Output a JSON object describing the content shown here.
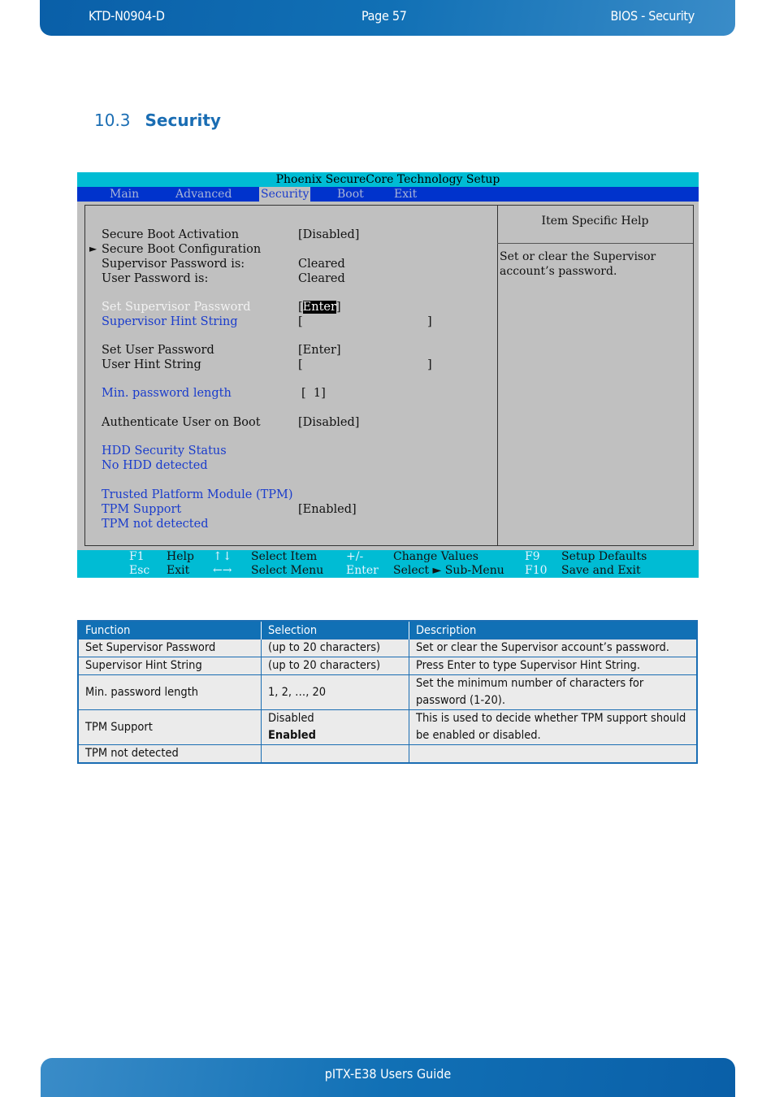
{
  "header": {
    "doc_id": "KTD-N0904-D",
    "page": "Page 57",
    "section": "BIOS  - Security"
  },
  "section": {
    "number": "10.3",
    "title": "Security"
  },
  "bios": {
    "title": "Phoenix SecureCore Technology Setup",
    "menu": [
      "Main",
      "Advanced",
      "Security",
      "Boot",
      "Exit"
    ],
    "active_menu": "Security",
    "items": [
      {
        "label": "Secure Boot Activation",
        "value": "[Disabled]",
        "color": "black"
      },
      {
        "label": "Secure Boot Configuration",
        "value": "",
        "color": "black",
        "submenu": true
      },
      {
        "label": "Supervisor Password is:",
        "value": "Cleared",
        "color": "black"
      },
      {
        "label": "User Password is:",
        "value": "Cleared",
        "color": "black"
      },
      {
        "label": "Set Supervisor Password",
        "value": "Enter",
        "color": "white",
        "selected": true
      },
      {
        "label": "Supervisor Hint String",
        "value": "[",
        "value_end": "]",
        "color": "blue"
      },
      {
        "label": "Set User Password",
        "value": "[Enter]",
        "color": "black"
      },
      {
        "label": "User Hint String",
        "value": "[",
        "value_end": "]",
        "color": "black"
      },
      {
        "label": "Min. password length",
        "value": "[  1]",
        "color": "blue"
      },
      {
        "label": "Authenticate User on Boot",
        "value": "[Disabled]",
        "color": "black"
      },
      {
        "label": "HDD Security Status",
        "value": "",
        "color": "blue"
      },
      {
        "label": "No HDD detected",
        "value": "",
        "color": "blue"
      },
      {
        "label": "Trusted Platform Module (TPM)",
        "value": "",
        "color": "blue"
      },
      {
        "label": "TPM Support",
        "value": "[Enabled]",
        "color": "blue"
      },
      {
        "label": "TPM not detected",
        "value": "",
        "color": "blue"
      }
    ],
    "help_title": "Item Specific Help",
    "help_text": "Set or clear the Supervisor account’s password.",
    "footer": [
      {
        "key": "F1",
        "desc": "Help"
      },
      {
        "key": "Esc",
        "desc": "Exit"
      },
      {
        "key": "↑↓",
        "desc": "Select Item"
      },
      {
        "key": "←→",
        "desc": "Select Menu"
      },
      {
        "key": "+/-",
        "desc": "Change Values"
      },
      {
        "key": "Enter",
        "desc": "Select ► Sub-Menu"
      },
      {
        "key": "F9",
        "desc": "Setup Defaults"
      },
      {
        "key": "F10",
        "desc": "Save and Exit"
      }
    ]
  },
  "table": {
    "headers": [
      "Function",
      "Selection",
      "Description"
    ],
    "rows": [
      {
        "function": "Set Supervisor Password",
        "selection": [
          "(up to 20 characters)"
        ],
        "description": "Set or clear the Supervisor account’s password."
      },
      {
        "function": "Supervisor Hint String",
        "selection": [
          "(up to 20 characters)"
        ],
        "description": "Press Enter to type Supervisor Hint String."
      },
      {
        "function": "Min. password length",
        "selection": [
          "1, 2, …, 20"
        ],
        "description": "Set the minimum number of characters for password (1-20)."
      },
      {
        "function": "TPM Support",
        "selection": [
          "Disabled",
          "Enabled"
        ],
        "selection_default": "Enabled",
        "description": "This is used to decide whether TPM support should be enabled or disabled."
      },
      {
        "function": "TPM not detected",
        "selection": [
          ""
        ],
        "description": ""
      }
    ]
  },
  "footer": {
    "title": "pITX-E38 Users Guide"
  },
  "colors": {
    "brand_blue": "#1170b5",
    "bios_cyan": "#00bcd4",
    "bios_menu_blue": "#0033cc",
    "bios_gray": "#c0c0c0",
    "bios_item_blue": "#1a3ccc"
  }
}
